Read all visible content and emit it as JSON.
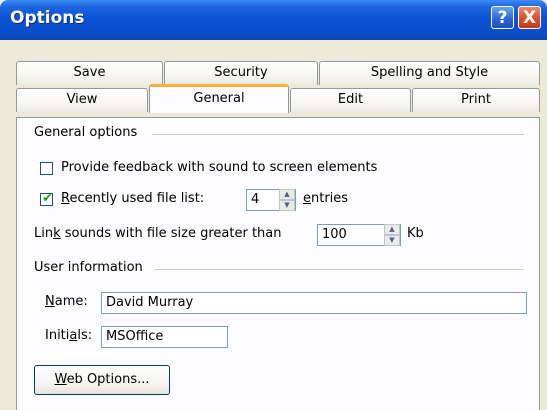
{
  "window": {
    "title": "Options",
    "help_label": "?",
    "close_label": "X"
  },
  "tabs_back": [
    {
      "label": "Save"
    },
    {
      "label": "Security"
    },
    {
      "label": "Spelling and Style"
    }
  ],
  "tabs_front": [
    {
      "label": "View"
    },
    {
      "label": "General",
      "active": true
    },
    {
      "label": "Edit"
    },
    {
      "label": "Print"
    }
  ],
  "general_options": {
    "group_label": "General options",
    "feedback_sound": {
      "label": "Provide feedback with sound to screen elements",
      "checked": false
    },
    "recent_files": {
      "label_pre": "R",
      "label_post": "ecently used file list:",
      "checked": true,
      "check_glyph": "✔",
      "value": "4",
      "suffix_pre": "e",
      "suffix_post": "ntries"
    },
    "link_sounds": {
      "label_pre": "Lin",
      "label_key": "k",
      "label_post": " sounds with file size greater than",
      "value": "100",
      "unit": "Kb"
    }
  },
  "user_information": {
    "group_label": "User information",
    "name": {
      "label_pre": "N",
      "label_post": "ame:",
      "value": "David Murray"
    },
    "initials": {
      "label_pre": "Initi",
      "label_key": "a",
      "label_post": "ls:",
      "value": "MSOffice"
    }
  },
  "buttons": {
    "web_options_pre": "W",
    "web_options_post": "eb Options..."
  },
  "spin_glyphs": {
    "up": "▲",
    "down": "▼"
  }
}
